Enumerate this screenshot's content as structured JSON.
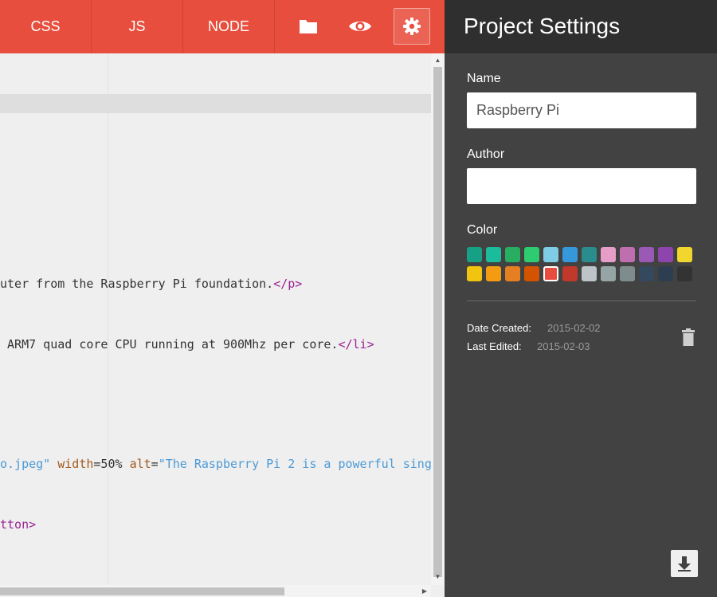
{
  "toolbar": {
    "tabs": [
      {
        "label": "CSS"
      },
      {
        "label": "JS"
      },
      {
        "label": "NODE"
      }
    ],
    "icons": [
      "folder-icon",
      "eye-icon",
      "gear-icon"
    ],
    "accent": "#e84e3d"
  },
  "editor": {
    "lines": [
      {
        "segments": [
          {
            "text": "uter from the Raspberry Pi foundation.",
            "cls": ""
          },
          {
            "text": "</p>",
            "cls": "tag"
          }
        ]
      },
      {
        "segments": [
          {
            "text": " ARM7 quad core CPU running at 900Mhz per core.",
            "cls": ""
          },
          {
            "text": "</li>",
            "cls": "tag"
          }
        ]
      },
      {
        "segments": [
          {
            "text": "o.jpeg\"",
            "cls": "str"
          },
          {
            "text": " ",
            "cls": ""
          },
          {
            "text": "width",
            "cls": "attr"
          },
          {
            "text": "=50% ",
            "cls": "num"
          },
          {
            "text": "alt",
            "cls": "attr"
          },
          {
            "text": "=",
            "cls": "num"
          },
          {
            "text": "\"The Raspberry Pi 2 is a powerful sing",
            "cls": "str"
          }
        ]
      },
      {
        "segments": [
          {
            "text": "tton>",
            "cls": "tag"
          }
        ]
      }
    ]
  },
  "settings": {
    "title": "Project Settings",
    "name_label": "Name",
    "name_value": "Raspberry Pi",
    "author_label": "Author",
    "author_value": "",
    "color_label": "Color",
    "colors": [
      "#16a085",
      "#1abc9c",
      "#27ae60",
      "#2ecc71",
      "#7fcce5",
      "#3498db",
      "#2a8c8c",
      "#e59ec8",
      "#bf6fb0",
      "#9b59b6",
      "#8e44ad",
      "#f1d62e",
      "#f1c40f",
      "#f39c12",
      "#e67e22",
      "#d35400",
      "#e74c3c",
      "#c0392b",
      "#bdc3c7",
      "#95a5a6",
      "#7f8c8d",
      "#34495e",
      "#2c3e50",
      "#333333"
    ],
    "selected_color": "#e74c3c",
    "date_created_label": "Date Created:",
    "date_created": "2015-02-02",
    "last_edited_label": "Last Edited:",
    "last_edited": "2015-02-03"
  }
}
